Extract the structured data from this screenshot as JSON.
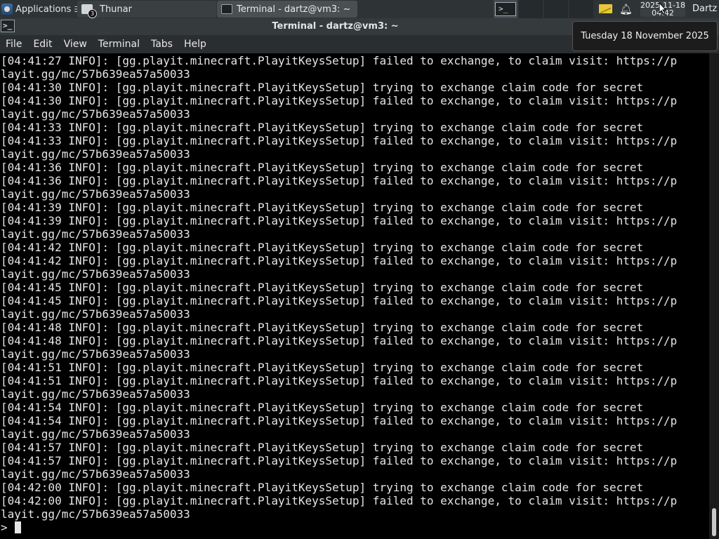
{
  "panel": {
    "applications_label": "Applications",
    "tasks": [
      {
        "label": "Thunar",
        "badge": "3"
      },
      {
        "label": "Terminal - dartz@vm3: ~"
      }
    ],
    "workspace_glyph": ">_",
    "clock_date": "2025-11-18",
    "clock_time": "04:42",
    "user": "Dartz"
  },
  "window": {
    "title": "Terminal - dartz@vm3: ~",
    "icon_glyph": ">_"
  },
  "menu": [
    "File",
    "Edit",
    "View",
    "Terminal",
    "Tabs",
    "Help"
  ],
  "terminal": {
    "lines": [
      "[04:41:27 INFO]: [gg.playit.minecraft.PlayitKeysSetup] failed to exchange, to claim visit: https://p",
      "layit.gg/mc/57b639ea57a50033",
      "[04:41:30 INFO]: [gg.playit.minecraft.PlayitKeysSetup] trying to exchange claim code for secret",
      "[04:41:30 INFO]: [gg.playit.minecraft.PlayitKeysSetup] failed to exchange, to claim visit: https://p",
      "layit.gg/mc/57b639ea57a50033",
      "[04:41:33 INFO]: [gg.playit.minecraft.PlayitKeysSetup] trying to exchange claim code for secret",
      "[04:41:33 INFO]: [gg.playit.minecraft.PlayitKeysSetup] failed to exchange, to claim visit: https://p",
      "layit.gg/mc/57b639ea57a50033",
      "[04:41:36 INFO]: [gg.playit.minecraft.PlayitKeysSetup] trying to exchange claim code for secret",
      "[04:41:36 INFO]: [gg.playit.minecraft.PlayitKeysSetup] failed to exchange, to claim visit: https://p",
      "layit.gg/mc/57b639ea57a50033",
      "[04:41:39 INFO]: [gg.playit.minecraft.PlayitKeysSetup] trying to exchange claim code for secret",
      "[04:41:39 INFO]: [gg.playit.minecraft.PlayitKeysSetup] failed to exchange, to claim visit: https://p",
      "layit.gg/mc/57b639ea57a50033",
      "[04:41:42 INFO]: [gg.playit.minecraft.PlayitKeysSetup] trying to exchange claim code for secret",
      "[04:41:42 INFO]: [gg.playit.minecraft.PlayitKeysSetup] failed to exchange, to claim visit: https://p",
      "layit.gg/mc/57b639ea57a50033",
      "[04:41:45 INFO]: [gg.playit.minecraft.PlayitKeysSetup] trying to exchange claim code for secret",
      "[04:41:45 INFO]: [gg.playit.minecraft.PlayitKeysSetup] failed to exchange, to claim visit: https://p",
      "layit.gg/mc/57b639ea57a50033",
      "[04:41:48 INFO]: [gg.playit.minecraft.PlayitKeysSetup] trying to exchange claim code for secret",
      "[04:41:48 INFO]: [gg.playit.minecraft.PlayitKeysSetup] failed to exchange, to claim visit: https://p",
      "layit.gg/mc/57b639ea57a50033",
      "[04:41:51 INFO]: [gg.playit.minecraft.PlayitKeysSetup] trying to exchange claim code for secret",
      "[04:41:51 INFO]: [gg.playit.minecraft.PlayitKeysSetup] failed to exchange, to claim visit: https://p",
      "layit.gg/mc/57b639ea57a50033",
      "[04:41:54 INFO]: [gg.playit.minecraft.PlayitKeysSetup] trying to exchange claim code for secret",
      "[04:41:54 INFO]: [gg.playit.minecraft.PlayitKeysSetup] failed to exchange, to claim visit: https://p",
      "layit.gg/mc/57b639ea57a50033",
      "[04:41:57 INFO]: [gg.playit.minecraft.PlayitKeysSetup] trying to exchange claim code for secret",
      "[04:41:57 INFO]: [gg.playit.minecraft.PlayitKeysSetup] failed to exchange, to claim visit: https://p",
      "layit.gg/mc/57b639ea57a50033",
      "[04:42:00 INFO]: [gg.playit.minecraft.PlayitKeysSetup] trying to exchange claim code for secret",
      "[04:42:00 INFO]: [gg.playit.minecraft.PlayitKeysSetup] failed to exchange, to claim visit: https://p",
      "layit.gg/mc/57b639ea57a50033"
    ],
    "prompt": ">"
  },
  "date_popup": "Tuesday 18 November 2025",
  "colors": {
    "panel_bg": "#2e3436",
    "terminal_bg": "#000000",
    "terminal_fg": "#e5e5e5",
    "mail_icon": "#e8c93a"
  }
}
